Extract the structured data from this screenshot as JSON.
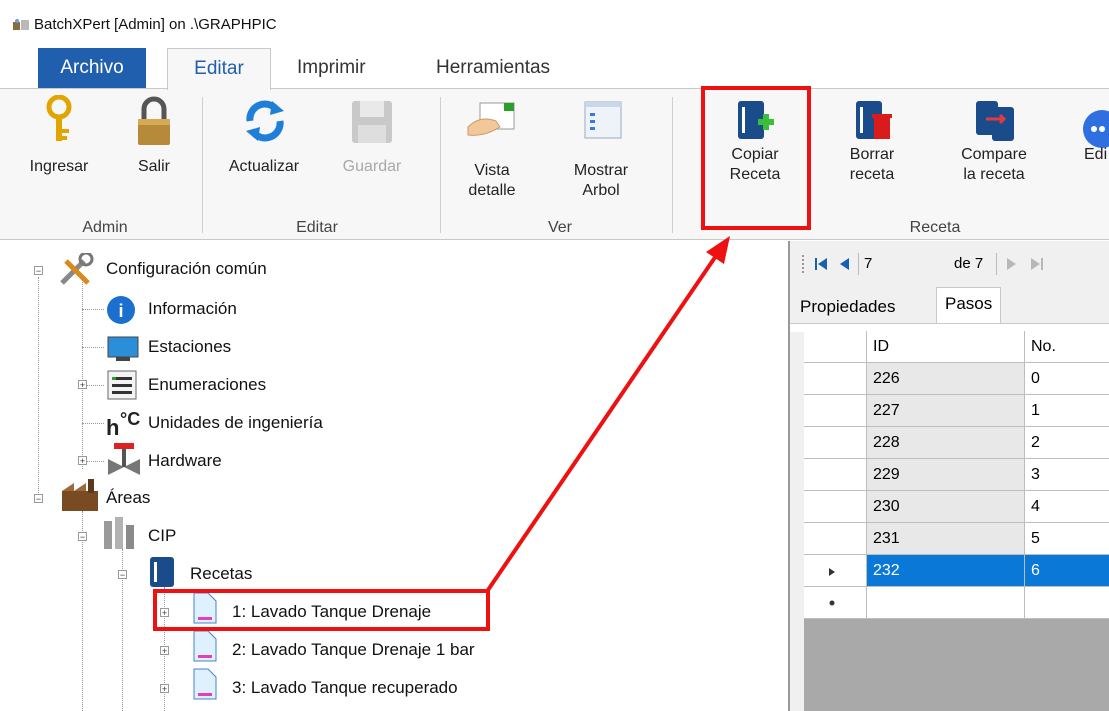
{
  "window": {
    "title": "BatchXPert [Admin] on .\\GRAPHPIC"
  },
  "tabs": [
    {
      "label": "Archivo"
    },
    {
      "label": "Editar"
    },
    {
      "label": "Imprimir"
    },
    {
      "label": "Herramientas"
    }
  ],
  "ribbon": {
    "admin": {
      "group": "Admin",
      "ingresar": "Ingresar",
      "salir": "Salir"
    },
    "editar": {
      "group": "Editar",
      "actualizar": "Actualizar",
      "guardar": "Guardar"
    },
    "ver": {
      "group": "Ver",
      "vista_line1": "Vista",
      "vista_line2": "detalle",
      "mostrar_line1": "Mostrar",
      "mostrar_line2": "Arbol"
    },
    "receta": {
      "group": "Receta",
      "copiar_line1": "Copiar",
      "copiar_line2": "Receta",
      "borrar_line1": "Borrar",
      "borrar_line2": "receta",
      "compare_line1": "Compare",
      "compare_line2": "la receta",
      "edit_partial": "Edi"
    }
  },
  "tree": {
    "configuracion": "Configuración común",
    "informacion": "Información",
    "estaciones": "Estaciones",
    "enumeraciones": "Enumeraciones",
    "unidades": "Unidades de ingeniería",
    "hardware": "Hardware",
    "areas": "Áreas",
    "cip": "CIP",
    "recetas": "Recetas",
    "recipes": [
      "1: Lavado Tanque Drenaje",
      "2: Lavado Tanque Drenaje 1 bar",
      "3: Lavado Tanque recuperado"
    ]
  },
  "navigator": {
    "position": "7",
    "of_label": "de 7"
  },
  "detail_tabs": [
    {
      "label": "Propiedades"
    },
    {
      "label": "Pasos"
    }
  ],
  "grid": {
    "headers": [
      "ID",
      "No."
    ],
    "rows": [
      {
        "id": "226",
        "no": "0"
      },
      {
        "id": "227",
        "no": "1"
      },
      {
        "id": "228",
        "no": "2"
      },
      {
        "id": "229",
        "no": "3"
      },
      {
        "id": "230",
        "no": "4"
      },
      {
        "id": "231",
        "no": "5"
      },
      {
        "id": "232",
        "no": "6"
      }
    ]
  },
  "colors": {
    "accent": "#1f5fae",
    "selection": "#0a78d7",
    "annotation": "#ee1111"
  }
}
